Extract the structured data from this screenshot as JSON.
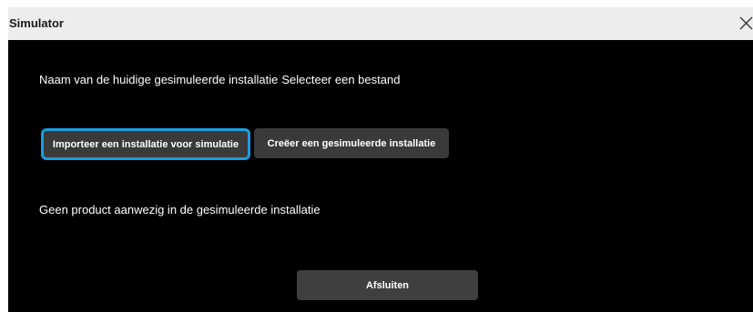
{
  "dialog": {
    "title": "Simulator",
    "close_icon": "close-icon",
    "current_installation_label": "Naam van de huidige gesimuleerde installatie",
    "current_installation_value": "Selecteer een bestand",
    "import_button_label": "Importeer een installatie voor simulatie",
    "create_button_label": "Creëer een gesimuleerde installatie",
    "empty_message": "Geen product aanwezig in de gesimuleerde installatie",
    "close_button_label": "Afsluiten"
  },
  "colors": {
    "titlebar_bg": "#ededed",
    "dialog_bg": "#000000",
    "button_bg": "#3a3a3a",
    "focus_ring": "#1a9de0",
    "text": "#ffffff"
  }
}
